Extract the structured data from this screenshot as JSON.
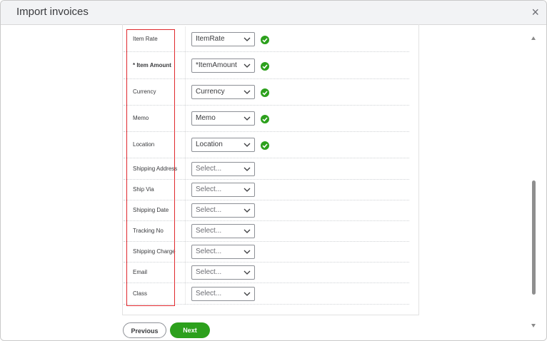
{
  "dialog": {
    "title": "Import invoices",
    "close_symbol": "×"
  },
  "fields": [
    {
      "label": "Item Rate",
      "required": false,
      "selected": "ItemRate",
      "mapped": true
    },
    {
      "label": "* Item Amount",
      "required": true,
      "selected": "*ItemAmount",
      "mapped": true
    },
    {
      "label": "Currency",
      "required": false,
      "selected": "Currency",
      "mapped": true
    },
    {
      "label": "Memo",
      "required": false,
      "selected": "Memo",
      "mapped": true
    },
    {
      "label": "Location",
      "required": false,
      "selected": "Location",
      "mapped": true
    },
    {
      "label": "Shipping Address",
      "required": false,
      "selected": "Select...",
      "mapped": false
    },
    {
      "label": "Ship Via",
      "required": false,
      "selected": "Select...",
      "mapped": false
    },
    {
      "label": "Shipping Date",
      "required": false,
      "selected": "Select...",
      "mapped": false
    },
    {
      "label": "Tracking No",
      "required": false,
      "selected": "Select...",
      "mapped": false
    },
    {
      "label": "Shipping Charge",
      "required": false,
      "selected": "Select...",
      "mapped": false
    },
    {
      "label": "Email",
      "required": false,
      "selected": "Select...",
      "mapped": false
    },
    {
      "label": "Class",
      "required": false,
      "selected": "Select...",
      "mapped": false
    }
  ],
  "buttons": {
    "previous": "Previous",
    "next": "Next"
  },
  "colors": {
    "accent": "#2ca01c",
    "highlight_box": "#e0282d",
    "check": "#2ca01c"
  },
  "icons": {
    "close": "close-icon",
    "chevron": "chevron-down-icon",
    "check": "check-circle-icon"
  }
}
